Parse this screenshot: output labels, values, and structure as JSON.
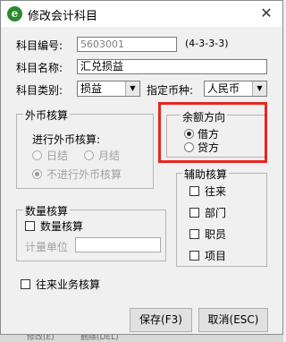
{
  "dialog": {
    "title": "修改会计科目",
    "app_icon_letter": "e",
    "close_glyph": "✕"
  },
  "form": {
    "code_label": "科目编号:",
    "code_value": "5603001",
    "code_hint": "(4-3-3-3)",
    "name_label": "科目名称:",
    "name_value": "汇兑损益",
    "category_label": "科目类别:",
    "category_value": "损益",
    "currency_label": "指定币种:",
    "currency_value": "人民币"
  },
  "foreign": {
    "title": "外币核算",
    "prompt": "进行外币核算:",
    "options": [
      "日结",
      "月结",
      "不进行外币核算"
    ],
    "selected_index": 2
  },
  "balance": {
    "title": "余额方向",
    "options": [
      "借方",
      "贷方"
    ],
    "selected_index": 0
  },
  "aux": {
    "title": "辅助核算",
    "items": [
      "往来",
      "部门",
      "职员",
      "项目"
    ]
  },
  "quantity": {
    "title": "数量核算",
    "checkbox_label": "数量核算",
    "unit_label": "计量单位",
    "unit_value": ""
  },
  "business": {
    "checkbox_label": "往来业务核算"
  },
  "buttons": {
    "save": "保存(F3)",
    "cancel": "取消(ESC)"
  },
  "background_strip": {
    "text_left": "修改(E)",
    "text_right": "删除(DEL)"
  },
  "colors": {
    "highlight_border": "#e8261f",
    "app_icon": "#2c8a2c"
  }
}
